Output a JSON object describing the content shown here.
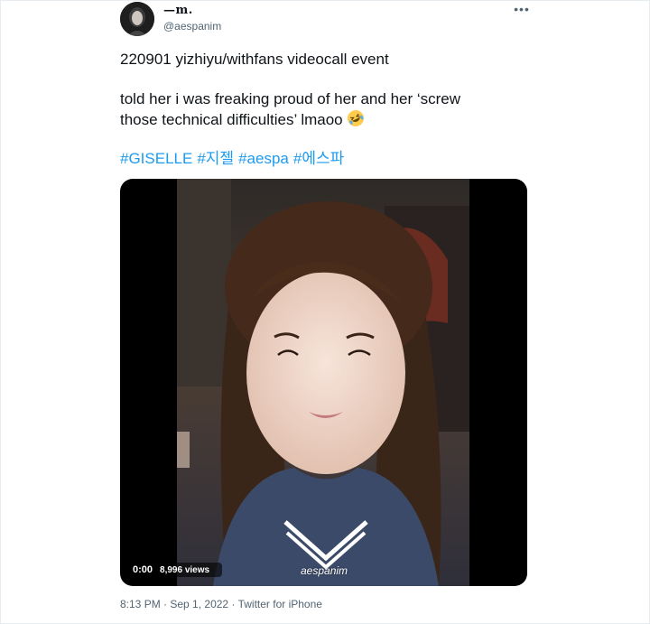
{
  "author": {
    "display_name": "—m.",
    "handle": "@aespanim"
  },
  "more_label": "•••",
  "tweet": {
    "line1": "220901 yizhiyu/withfans videocall event",
    "line2": "told her i was freaking proud of her and her ‘screw",
    "line3": "those technical difficulties’ lmaoo",
    "emoji_icon": "rolling-on-floor-laughing-emoji",
    "hashtags": [
      "#GISELLE",
      "#지젤",
      "#aespa",
      "#에스파"
    ]
  },
  "media": {
    "time": "0:00",
    "views": "8,996 views",
    "watermark": "aespanim"
  },
  "meta": {
    "time": "8:13 PM",
    "sep1": " · ",
    "date": "Sep 1, 2022",
    "sep2": " · ",
    "source": "Twitter for iPhone"
  },
  "colors": {
    "link": "#1d9bf0",
    "muted": "#536471",
    "text": "#0f1419"
  }
}
